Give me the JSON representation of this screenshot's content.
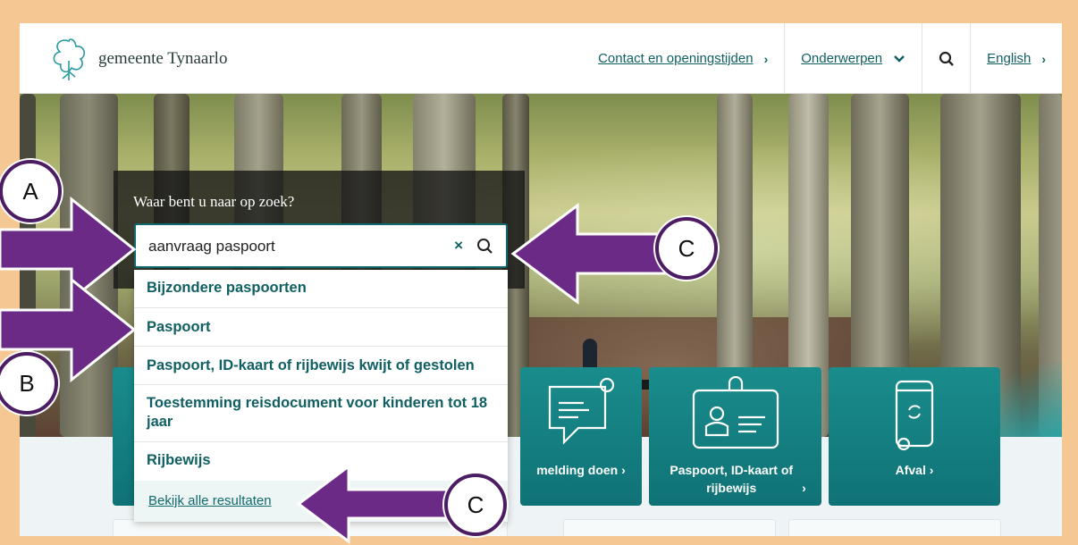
{
  "site": {
    "name": "gemeente Tynaarlo"
  },
  "nav": {
    "contact": "Contact en openingstijden",
    "topics": "Onderwerpen",
    "english": "English"
  },
  "search": {
    "heading": "Waar bent u naar op zoek?",
    "value": "aanvraag paspoort",
    "clear_icon": "×"
  },
  "suggestions": [
    "Bijzondere paspoorten",
    "Paspoort",
    "Paspoort, ID-kaart of rijbewijs kwijt of gestolen",
    "Toestemming reisdocument voor kinderen tot 18 jaar",
    "Rijbewijs"
  ],
  "all_results": "Bekijk alle resultaten",
  "tiles": [
    {
      "label": "melding doen",
      "icon": "chat-bubble-icon"
    },
    {
      "label": "Paspoort, ID-kaart of rijbewijs",
      "icon": "id-card-icon"
    },
    {
      "label": "Afval",
      "icon": "recycle-bin-icon"
    }
  ],
  "annotations": {
    "a": "A",
    "b": "B",
    "c1": "C",
    "c2": "C"
  },
  "colors": {
    "brand": "#0f6a6e",
    "annotation": "#6a2a86",
    "border": "#f5c893"
  }
}
